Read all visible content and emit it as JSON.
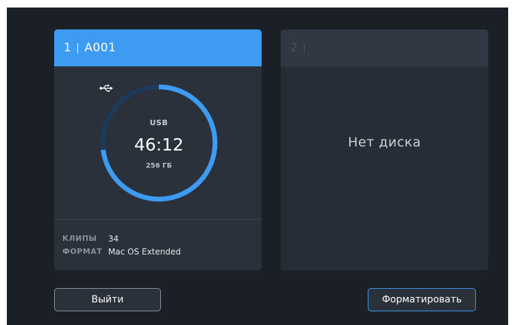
{
  "slot1": {
    "number": "1",
    "name": "A001",
    "media_type": "USB",
    "time_remaining": "46:12",
    "capacity": "256 ГБ",
    "fill_fraction": 0.73,
    "clips_label": "КЛИПЫ",
    "clips_value": "34",
    "format_label": "ФОРМАТ",
    "format_value": "Mac OS Extended",
    "usb_icon": "usb-icon"
  },
  "slot2": {
    "number": "2",
    "status": "Нет диска"
  },
  "buttons": {
    "exit_label": "Выйти",
    "format_label": "Форматировать"
  },
  "colors": {
    "accent": "#3d9bf2",
    "background": "#1b1f26",
    "card": "#2a313b"
  }
}
